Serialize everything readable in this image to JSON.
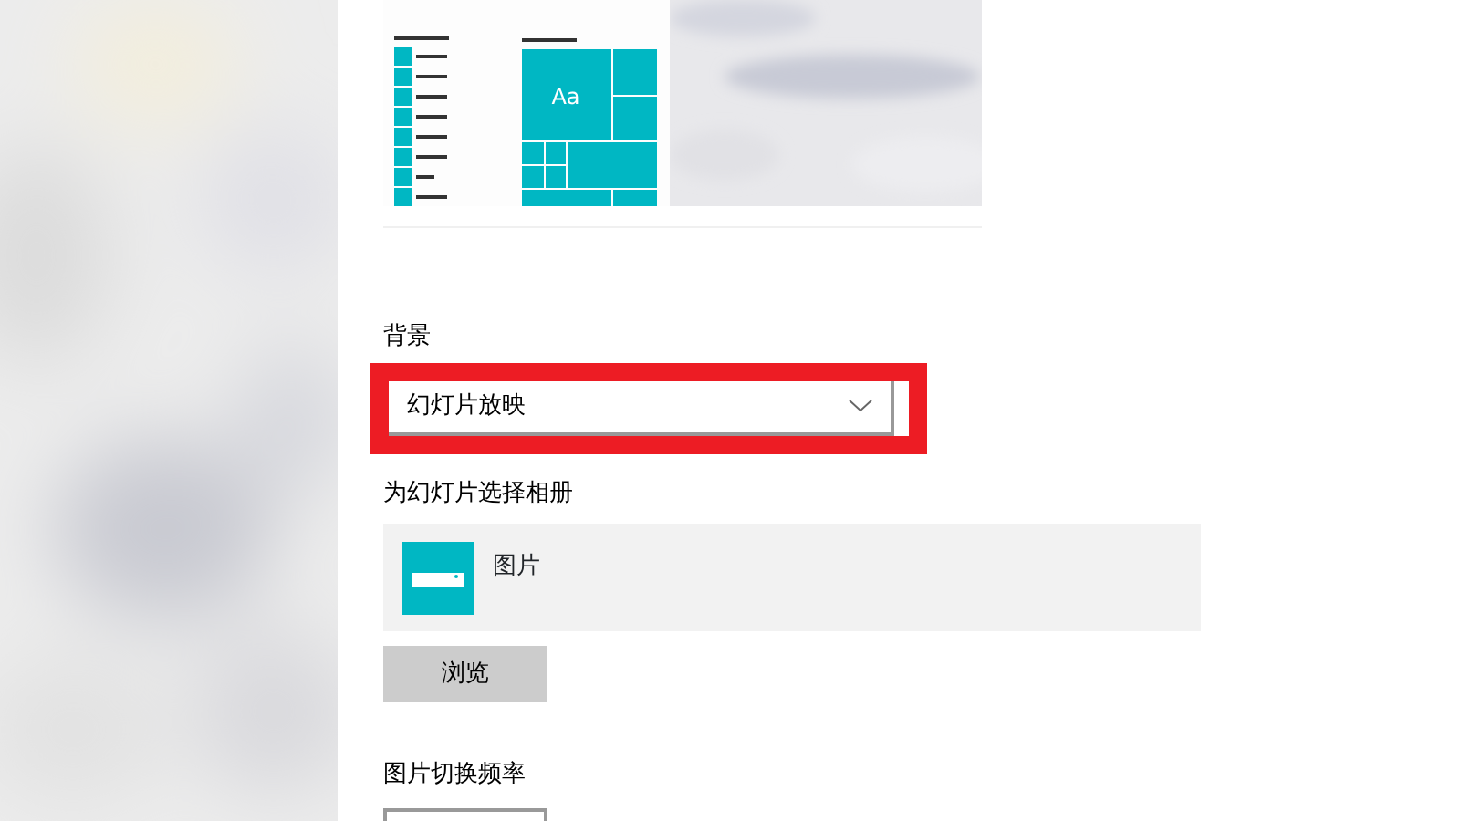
{
  "preview": {
    "sample_text": "Aa"
  },
  "background": {
    "label": "背景",
    "value": "幻灯片放映",
    "highlighted": true
  },
  "album": {
    "label": "为幻灯片选择相册",
    "items": [
      {
        "name": "图片"
      }
    ]
  },
  "browse_button": "浏览",
  "interval": {
    "label": "图片切换频率"
  }
}
